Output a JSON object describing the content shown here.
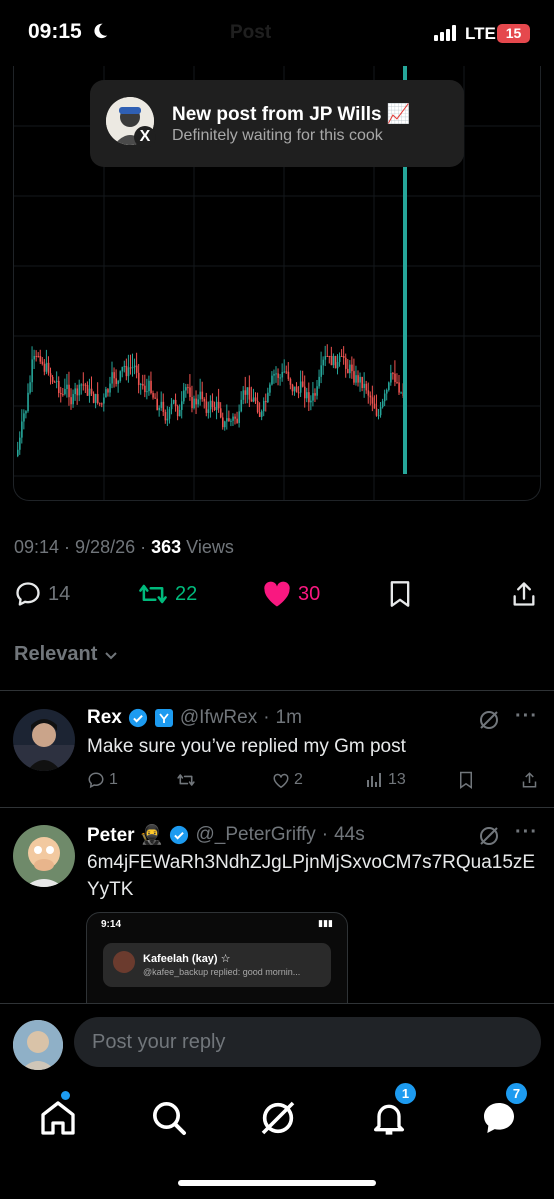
{
  "status_bar": {
    "time": "09:15",
    "network": "LTE",
    "battery": "15"
  },
  "header": {
    "title": "Post"
  },
  "notification": {
    "title": "New post from JP Wills 📈",
    "body": "Definitely waiting for this cook",
    "badge": "X"
  },
  "post": {
    "time": "09:14",
    "date": "9/28/26",
    "views": "363",
    "views_label": "Views",
    "replies": "14",
    "reposts": "22",
    "likes": "30"
  },
  "sort": {
    "label": "Relevant"
  },
  "replies": [
    {
      "name": "Rex",
      "handle": "@IfwRex",
      "time": "1m",
      "text": "Make sure you’ve replied my Gm post",
      "replies": "1",
      "reposts": "",
      "likes": "2",
      "views": "13"
    },
    {
      "name": "Peter 🥷",
      "handle": "@_PeterGriffy",
      "time": "44s",
      "text": "6m4jFEWaRh3NdhZJgLPjnMjSxvoCM7s7RQua15zEYyTK",
      "embedded": {
        "time": "9:14",
        "title": "Kafeelah (kay) ☆",
        "body": "@kafee_backup replied: good mornin..."
      }
    }
  ],
  "composer": {
    "placeholder": "Post your reply"
  },
  "tabs": {
    "notifications_badge": "1",
    "messages_badge": "7"
  },
  "colors": {
    "accent": "#1d9bf0",
    "repost": "#00ba7c",
    "like": "#f91880",
    "chart_green": "#26a69a",
    "chart_red": "#ef5350"
  }
}
